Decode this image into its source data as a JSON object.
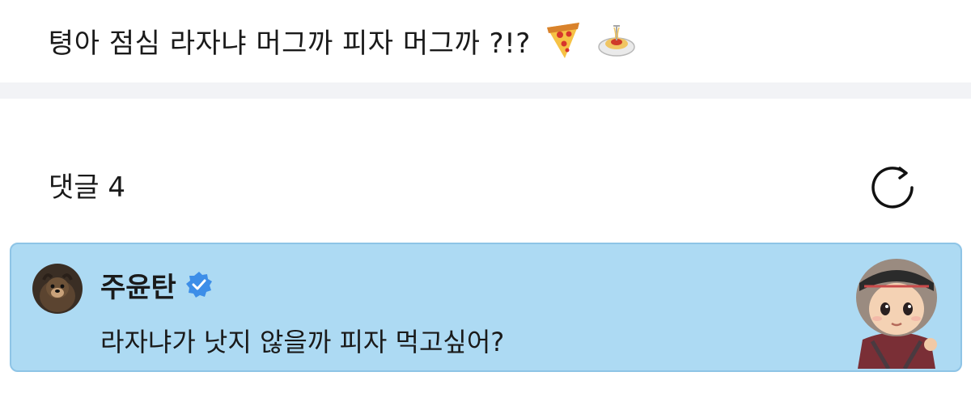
{
  "post": {
    "text": "텽아 점심 라자냐 머그까 피자 머그까 ?!?",
    "emojis": [
      "pizza-icon",
      "spaghetti-icon"
    ]
  },
  "comments": {
    "title": "댓글 4",
    "refresh_icon": "refresh-icon"
  },
  "comment": {
    "author": "주윤탄",
    "verified_icon": "verified-badge-icon",
    "body": "라자냐가 낫지 않을까 피자 먹고싶어?",
    "highlight_color": "#addaf3",
    "verified_color": "#3d8ee8"
  }
}
